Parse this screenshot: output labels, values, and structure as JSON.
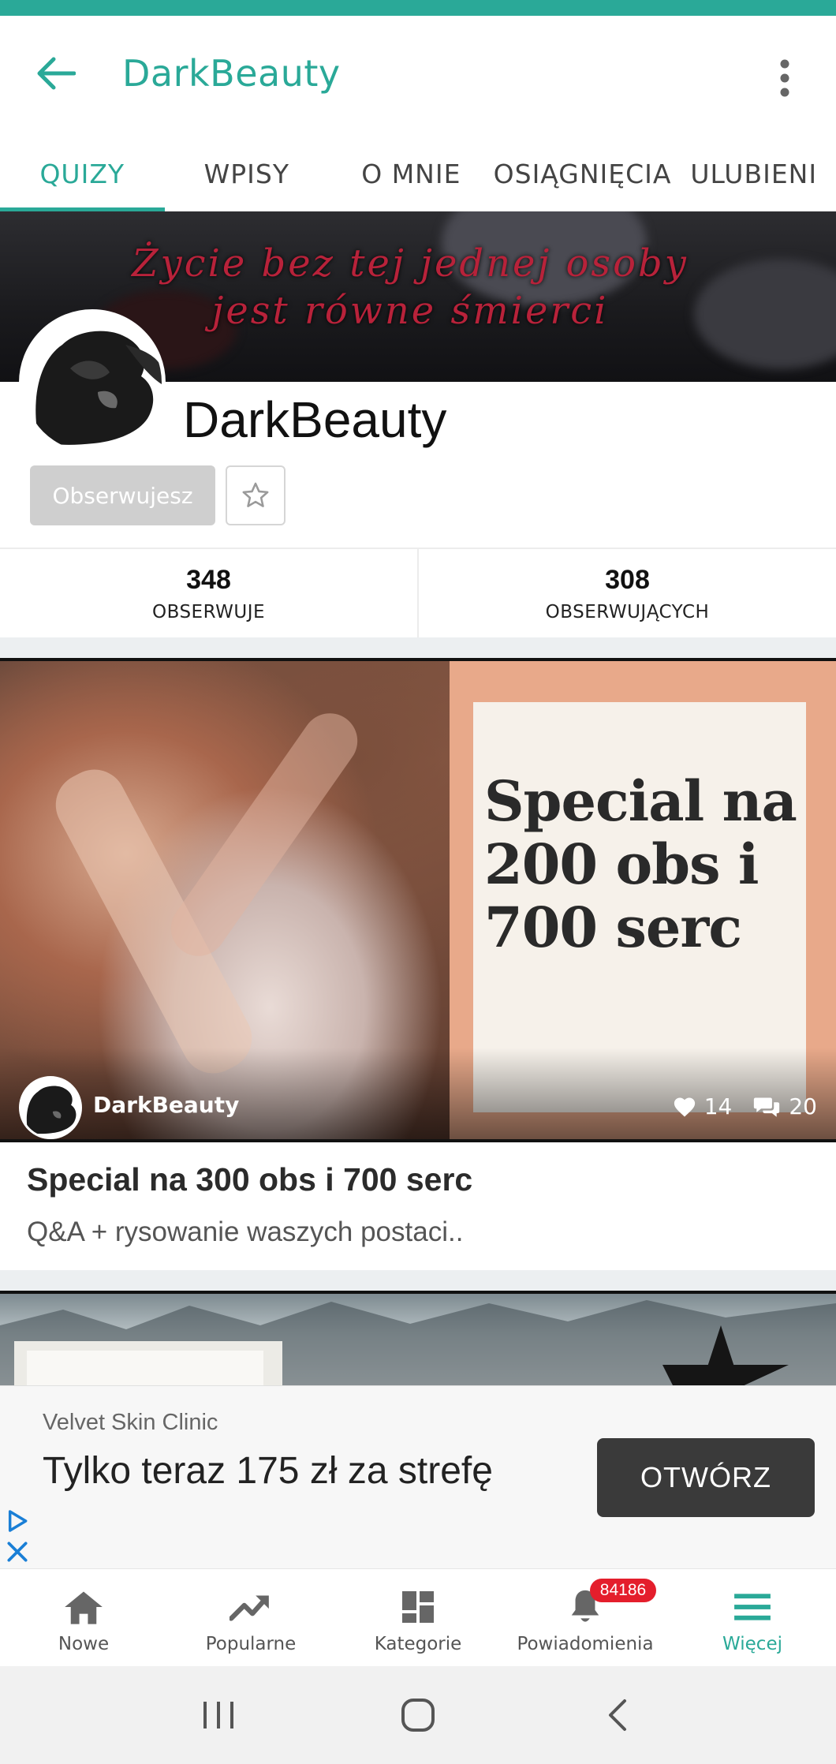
{
  "app_bar": {
    "title": "DarkBeauty",
    "back_icon": "arrow-left-icon",
    "more_icon": "more-vertical-icon"
  },
  "tabs": [
    {
      "label": "QUIZY",
      "active": true
    },
    {
      "label": "WPISY",
      "active": false
    },
    {
      "label": "O MNIE",
      "active": false
    },
    {
      "label": "OSIĄGNIĘCIA",
      "active": false
    },
    {
      "label": "ULUBIENI",
      "active": false
    }
  ],
  "cover": {
    "line1": "Życie bez tej jednej osoby",
    "line2": "jest równe śmierci"
  },
  "profile": {
    "name": "DarkBeauty",
    "follow_label": "Obserwujesz",
    "favorite_icon": "star-outline-icon"
  },
  "stats": [
    {
      "value": "348",
      "label": "OBSERWUJE"
    },
    {
      "value": "308",
      "label": "OBSERWUJĄCYCH"
    }
  ],
  "quiz_card": {
    "image_text": "Special na 200 obs i 700 serc",
    "author": "DarkBeauty",
    "likes": "14",
    "comments": "20",
    "title": "Special na 300 obs i 700 serc",
    "description": "Q&A + rysowanie waszych postaci.."
  },
  "ad": {
    "brand": "Velvet Skin Clinic",
    "text": "Tylko teraz 175 zł za strefę",
    "button_label": "OTWÓRZ"
  },
  "bottom_nav": [
    {
      "label": "Nowe",
      "icon": "home-icon",
      "active": false
    },
    {
      "label": "Popularne",
      "icon": "trending-icon",
      "active": false
    },
    {
      "label": "Kategorie",
      "icon": "dashboard-icon",
      "active": false
    },
    {
      "label": "Powiadomienia",
      "icon": "bell-icon",
      "active": false,
      "badge": "84186"
    },
    {
      "label": "Więcej",
      "icon": "menu-icon",
      "active": true
    }
  ],
  "colors": {
    "accent": "#2aa998",
    "badge": "#e41e2c",
    "follow_button": "#cfcfcf",
    "ad_button": "#3a3a3a"
  }
}
